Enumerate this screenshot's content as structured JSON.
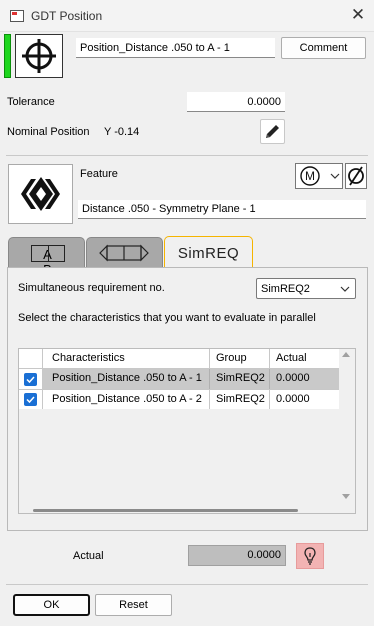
{
  "window": {
    "title": "GDT Position",
    "close_icon": "close-icon",
    "app_icon": "window-app-icon"
  },
  "header": {
    "symbol_icon": "position-symbol-icon",
    "status_color": "#1ed61e",
    "name_value": "Position_Distance .050 to A - 1",
    "comment_label": "Comment"
  },
  "tolerance": {
    "label": "Tolerance",
    "value": "0.0000"
  },
  "nominal": {
    "label": "Nominal Position",
    "value": "Y -0.14",
    "edit_icon": "pencil-icon"
  },
  "feature": {
    "label": "Feature",
    "icon": "symmetry-plane-icon",
    "value": "Distance .050 - Symmetry Plane - 1",
    "modifier_icon": "mmc-modifier-icon",
    "diameter_icon": "diameter-icon"
  },
  "tabs": [
    {
      "label": "A B",
      "icon": "datum-reference-icon",
      "active": false
    },
    {
      "label": "",
      "icon": "feature-arrows-icon",
      "active": false
    },
    {
      "label": "SimREQ",
      "active": true
    }
  ],
  "simreq": {
    "req_label": "Simultaneous requirement no.",
    "req_value": "SimREQ2",
    "instruction": "Select the characteristics that you want to evaluate in parallel",
    "columns": [
      "Characteristics",
      "Group",
      "Actual"
    ],
    "rows": [
      {
        "checked": true,
        "characteristic": "Position_Distance .050 to A - 1",
        "group": "SimREQ2",
        "actual": "0.0000",
        "highlighted": true
      },
      {
        "checked": true,
        "characteristic": "Position_Distance .050 to A - 2",
        "group": "SimREQ2",
        "actual": "0.0000",
        "highlighted": false
      }
    ]
  },
  "actual": {
    "label": "Actual",
    "value": "0.0000",
    "hint_icon": "lightbulb-icon"
  },
  "footer": {
    "ok_label": "OK",
    "reset_label": "Reset"
  }
}
